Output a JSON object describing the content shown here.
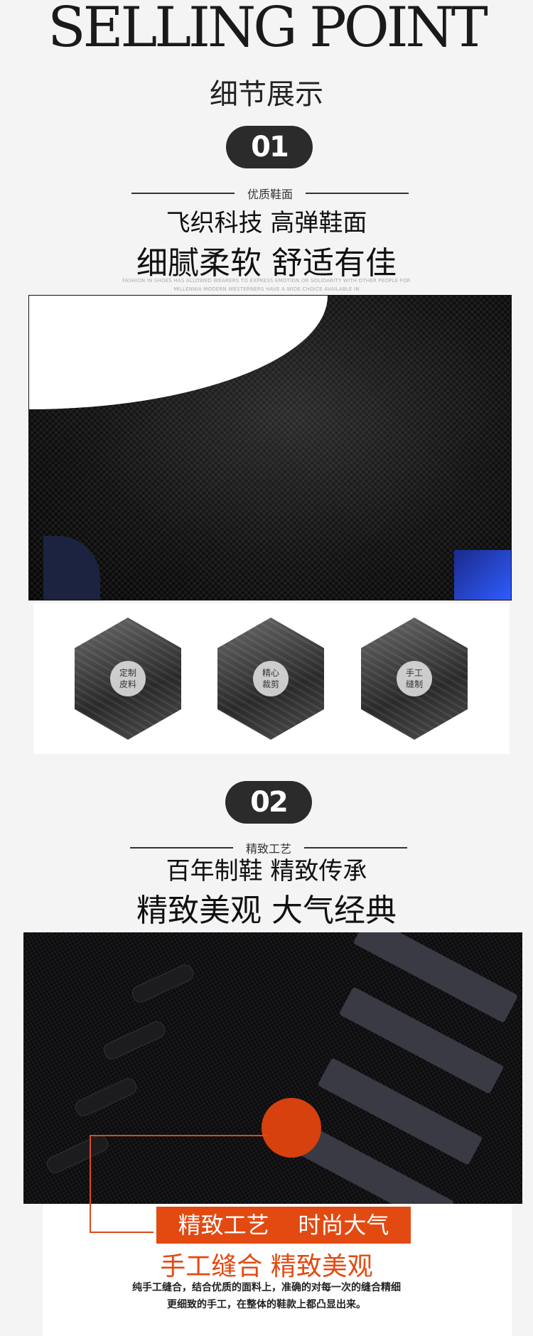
{
  "header": {
    "title": "SELLING POINT",
    "subtitle": "细节展示"
  },
  "section1": {
    "number": "01",
    "rule_label": "优质鞋面",
    "headline_line1": "飞织科技 高弹鞋面",
    "headline_line2": "细腻柔软  舒适有佳",
    "fine_print_line1": "FASHION IN SHOES HAS ALLOWED WEARERS TO EXPRESS EMOTION OR SOLIDARITY WITH OTHER PEOPLE FOR",
    "fine_print_line2": "MILLENNIA MODERN WESTERNERS HAVE A WIDE CHOICE AVAILABLE IN",
    "features": [
      {
        "line1": "定制",
        "line2": "皮料",
        "icon": "leather-cutting-icon"
      },
      {
        "line1": "精心",
        "line2": "裁剪",
        "icon": "scissors-cutting-icon"
      },
      {
        "line1": "手工",
        "line2": "缝制",
        "icon": "hand-sewing-icon"
      }
    ]
  },
  "section2": {
    "number": "02",
    "rule_label": "精致工艺",
    "headline_line1": "百年制鞋  精致传承",
    "headline_line2": "精致美观  大气经典",
    "banner": "精致工艺    时尚大气",
    "orange_title": "手工缝合  精致美观",
    "desc_line1": "纯手工缝合，结合优质的面料上，准确的对每一次的缝合精细",
    "desc_line2": "更细致的手工，在整体的鞋款上都凸显出来。"
  },
  "colors": {
    "accent": "#e24a12",
    "pill": "#2b2b2b",
    "background": "#f4f4f4"
  }
}
